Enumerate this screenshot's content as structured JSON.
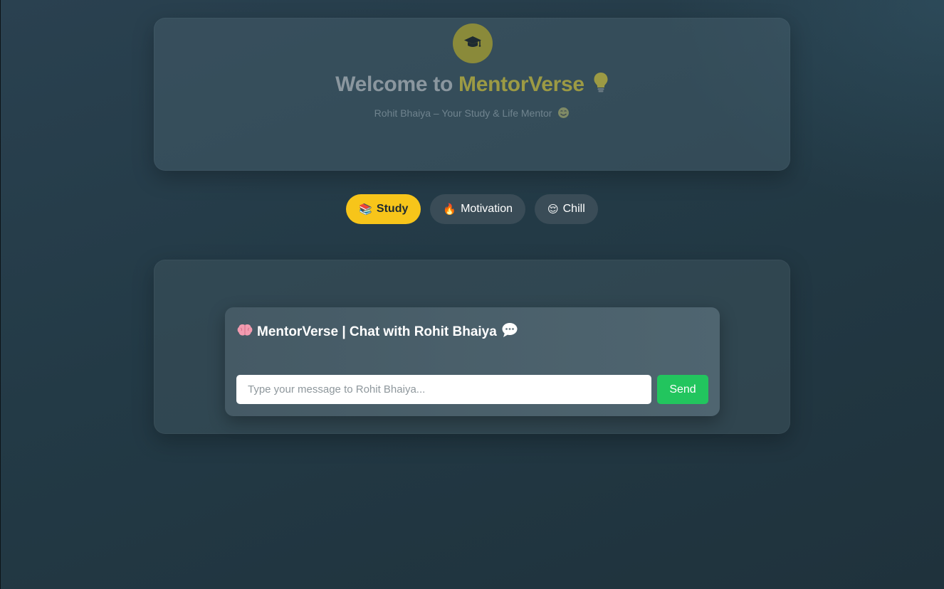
{
  "header": {
    "logo_icon": "graduation-cap-icon",
    "title_prefix": "Welcome to ",
    "title_brand": "MentorVerse",
    "title_icon": "lightbulb-icon",
    "subtitle": "Rohit Bhaiya – Your Study & Life Mentor",
    "subtitle_icon": "smiling-face-icon"
  },
  "modes": [
    {
      "label": "Study",
      "icon": "books-icon",
      "emoji": "📚",
      "active": true
    },
    {
      "label": "Motivation",
      "icon": "fire-icon",
      "emoji": "🔥",
      "active": false
    },
    {
      "label": "Chill",
      "icon": "relieved-face-icon",
      "emoji": "😌",
      "active": false
    }
  ],
  "chat": {
    "title": "MentorVerse | Chat with Rohit Bhaiya",
    "title_left_icon": "brain-icon",
    "title_right_icon": "speech-bubble-icon",
    "input_value": "",
    "input_placeholder": "Type your message to Rohit Bhaiya...",
    "send_label": "Send"
  },
  "colors": {
    "accent_yellow": "#f7c51a",
    "brand_olive": "#9c9a44",
    "send_green": "#22c55e"
  }
}
